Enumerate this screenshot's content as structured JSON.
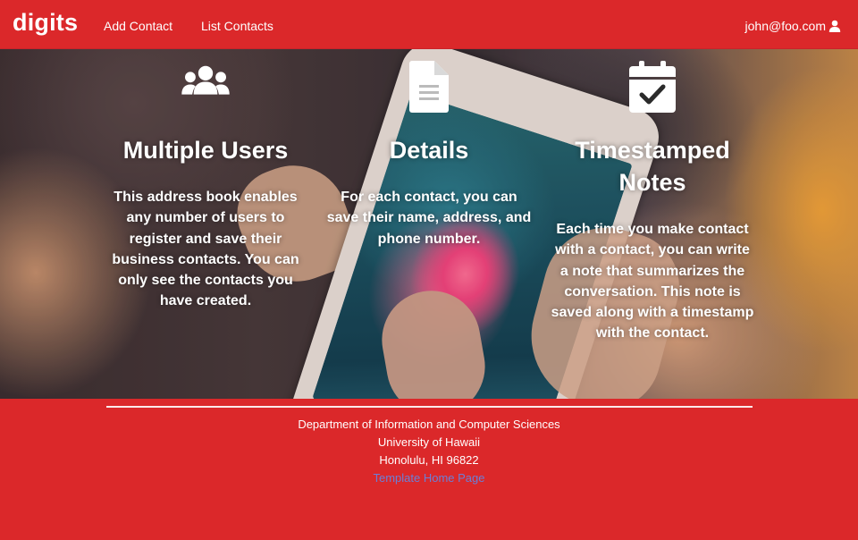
{
  "navbar": {
    "brand": "digits",
    "links": [
      "Add Contact",
      "List Contacts"
    ],
    "user_email": "john@foo.com"
  },
  "features": [
    {
      "icon": "users-icon",
      "title": "Multiple Users",
      "text": "This address book enables any number of users to register and save their business contacts. You can only see the contacts you have created."
    },
    {
      "icon": "file-text-icon",
      "title": "Details",
      "text": "For each contact, you can save their name, address, and phone number."
    },
    {
      "icon": "calendar-check-icon",
      "title": "Timestamped Notes",
      "text": "Each time you make contact with a contact, you can write a note that summarizes the conversation. This note is saved along with a timestamp with the contact."
    }
  ],
  "footer": {
    "lines": [
      "Department of Information and Computer Sciences",
      "University of Hawaii",
      "Honolulu, HI 96822"
    ],
    "link_text": "Template Home Page"
  },
  "colors": {
    "primary_red": "#db282a",
    "link_blue": "#6b7fd6"
  }
}
